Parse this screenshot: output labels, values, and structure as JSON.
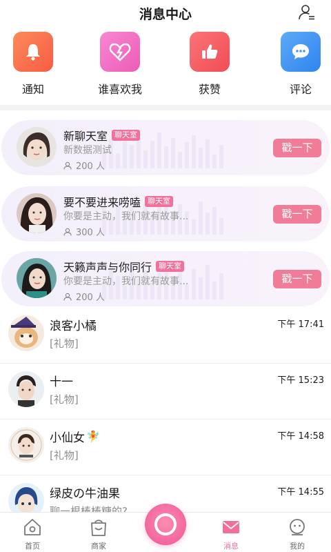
{
  "header": {
    "title": "消息中心",
    "icon": "user-list-icon"
  },
  "categories": [
    {
      "label": "通知",
      "icon": "bell-icon",
      "color": "#fb6e4f"
    },
    {
      "label": "谁喜欢我",
      "icon": "broken-heart-icon",
      "color": "#f26ec2"
    },
    {
      "label": "获赞",
      "icon": "thumbs-up-icon",
      "color": "#f5565a"
    },
    {
      "label": "评论",
      "icon": "comment-icon",
      "color": "#3f94f4"
    }
  ],
  "rooms": [
    {
      "name": "新聊天室",
      "tag": "聊天室",
      "desc": "新数据测试",
      "count": "200 人",
      "action": "戳一下"
    },
    {
      "name": "要不要进来唠嗑",
      "tag": "聊天室",
      "desc": "你要是主动，我们就有故事...",
      "count": "300 人",
      "action": "戳一下"
    },
    {
      "name": "天籁声声与你同行",
      "tag": "聊天室",
      "desc": "你要是主动，我们就有故事...",
      "count": "200 人",
      "action": "戳一下"
    }
  ],
  "messages": [
    {
      "name": "浪客小橘",
      "preview": "[礼物]",
      "time": "下午 17:41"
    },
    {
      "name": "十一",
      "preview": "[礼物]",
      "time": "下午 15:23"
    },
    {
      "name": "小仙女",
      "preview": "[礼物]",
      "time": "下午 14:58",
      "emoji": "🧚"
    },
    {
      "name": "绿皮の牛油果",
      "preview": "聊一根棒棒糖的?",
      "time": "下午 14:55"
    }
  ],
  "tabs": [
    {
      "label": "首页",
      "icon": "home-icon"
    },
    {
      "label": "商家",
      "icon": "shopping-bag-icon"
    },
    {
      "label": "消息",
      "icon": "mail-icon",
      "active": true
    },
    {
      "label": "我的",
      "icon": "profile-icon"
    }
  ],
  "accent": "#f26f9b"
}
